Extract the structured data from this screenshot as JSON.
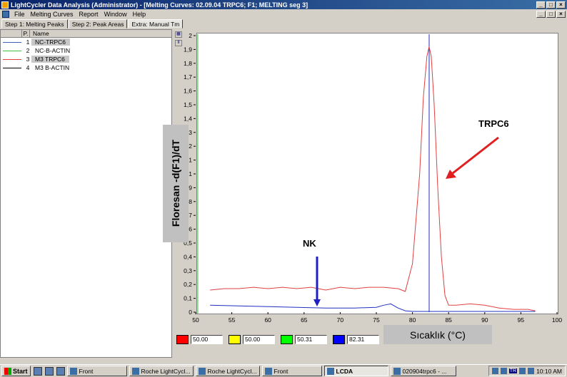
{
  "window": {
    "title": "LightCycler Data Analysis (Administrator)  - [Melting Curves: 02.09.04 TRPC6; F1; MELTING seg 3]",
    "buttons": [
      "_",
      "□",
      "×"
    ]
  },
  "menu": {
    "items": [
      "File",
      "Melting Curves",
      "Report",
      "Window",
      "Help"
    ]
  },
  "tabs": [
    "Step 1: Melting Peaks",
    "Step 2: Peak Areas",
    "Extra: Manual Tm"
  ],
  "sample_list": {
    "headers": {
      "col_p": "P.",
      "col_name": "Name"
    },
    "rows": [
      {
        "num": "1",
        "name": "NC-TRPC6",
        "color": "#4060c0",
        "selected": true
      },
      {
        "num": "2",
        "name": "NC-B-ACTIN",
        "color": "#40c040",
        "selected": false
      },
      {
        "num": "3",
        "name": "M3 TRPC6",
        "color": "#e04040",
        "selected": true
      },
      {
        "num": "4",
        "name": "M3 B-ACTIN",
        "color": "#000000",
        "selected": false
      }
    ]
  },
  "chart_data": {
    "type": "line",
    "xlabel": "Sıcaklık (°C)",
    "ylabel": "Floresan -d(F1)/dT",
    "xlim": [
      50,
      100
    ],
    "ylim": [
      0,
      2
    ],
    "x_ticks": [
      "50",
      "55",
      "60",
      "65",
      "70",
      "75",
      "80",
      "85",
      "90",
      "95",
      "100"
    ],
    "y_ticks": [
      "0",
      "0,1",
      "0,2",
      "0,3",
      "0,4",
      "0,5",
      "0,6",
      "0,7",
      "0,8",
      "0,9",
      "1",
      "1,1",
      "1,2",
      "1,3",
      "1,4",
      "1,5",
      "1,6",
      "1,7",
      "1,8",
      "1,9",
      "2"
    ],
    "vertical_marker_x": 82.31,
    "series": [
      {
        "color": "#e04040",
        "x": [
          52,
          54,
          56,
          58,
          60,
          62,
          64,
          66,
          68,
          70,
          72,
          74,
          76,
          78,
          79,
          80,
          81,
          81.5,
          82,
          82.3,
          82.6,
          83,
          83.5,
          84,
          84.5,
          85,
          86,
          88,
          90,
          92,
          94,
          96,
          97
        ],
        "y": [
          0.16,
          0.17,
          0.17,
          0.18,
          0.17,
          0.18,
          0.17,
          0.18,
          0.16,
          0.18,
          0.17,
          0.18,
          0.18,
          0.17,
          0.15,
          0.35,
          1.0,
          1.55,
          1.85,
          1.92,
          1.85,
          1.5,
          0.9,
          0.4,
          0.12,
          0.05,
          0.05,
          0.06,
          0.05,
          0.03,
          0.02,
          0.02,
          0.01
        ]
      },
      {
        "color": "#2030c0",
        "x": [
          52,
          56,
          60,
          64,
          68,
          72,
          75,
          76,
          77,
          78,
          79,
          80,
          82,
          85,
          88,
          92,
          96,
          97
        ],
        "y": [
          0.05,
          0.045,
          0.04,
          0.035,
          0.03,
          0.03,
          0.035,
          0.05,
          0.06,
          0.03,
          0.01,
          0.005,
          0.005,
          0.005,
          0.005,
          0.005,
          0.005,
          0.005
        ]
      }
    ],
    "annotations": [
      {
        "text": "NK",
        "arrow_color": "#2020c0"
      },
      {
        "text": "TRPC6",
        "arrow_color": "#e02020"
      }
    ]
  },
  "cursors": [
    {
      "color": "#ff0000",
      "value": "50.00"
    },
    {
      "color": "#ffff00",
      "value": "50.00"
    },
    {
      "color": "#00ff00",
      "value": "50.31"
    },
    {
      "color": "#0000ff",
      "value": "82.31"
    }
  ],
  "taskbar": {
    "start": "Start",
    "tasks": [
      {
        "label": "Front",
        "active": false
      },
      {
        "label": "Roche LightCycl...",
        "active": false
      },
      {
        "label": "Roche LightCycl...",
        "active": false
      },
      {
        "label": "Front",
        "active": false
      },
      {
        "label": "LCDA",
        "active": true
      },
      {
        "label": "020904trpc6 - ...",
        "active": false
      }
    ],
    "tray_lang": "TR",
    "clock": "10:10 AM"
  }
}
